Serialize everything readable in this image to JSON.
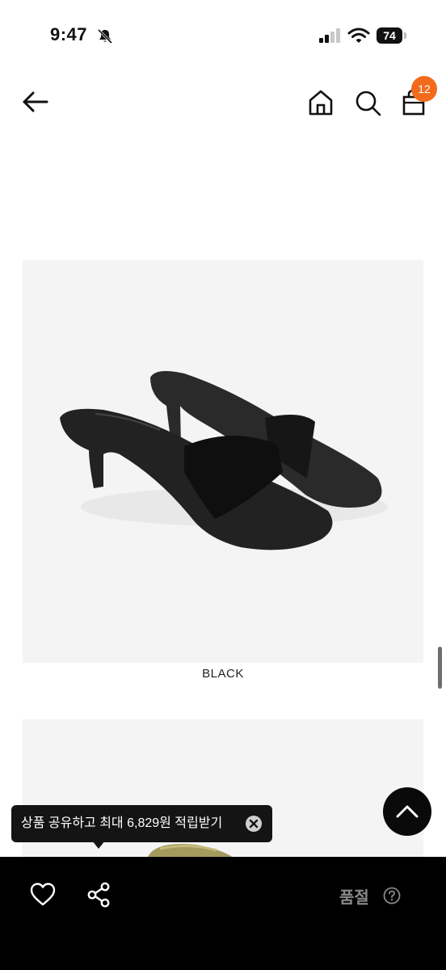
{
  "status_bar": {
    "time": "9:47",
    "battery": "74"
  },
  "header": {
    "cart_count": "12"
  },
  "product": {
    "color_label": "BLACK"
  },
  "share_tooltip": {
    "text": "상품 공유하고 최대 6,829원 적립받기"
  },
  "bottom_bar": {
    "status_label": "품절"
  },
  "icons": {
    "back": "arrow-left-icon",
    "home": "home-icon",
    "search": "search-icon",
    "cart": "shopping-bag-icon",
    "scroll_top": "chevron-up-icon",
    "like": "heart-icon",
    "share": "share-icon",
    "help": "question-circle-icon",
    "close": "close-icon",
    "mute": "bell-slash-icon"
  },
  "colors": {
    "badge": "#f26a1b",
    "bottom_bar": "#000000",
    "soldout_text": "#8a8a8a"
  }
}
